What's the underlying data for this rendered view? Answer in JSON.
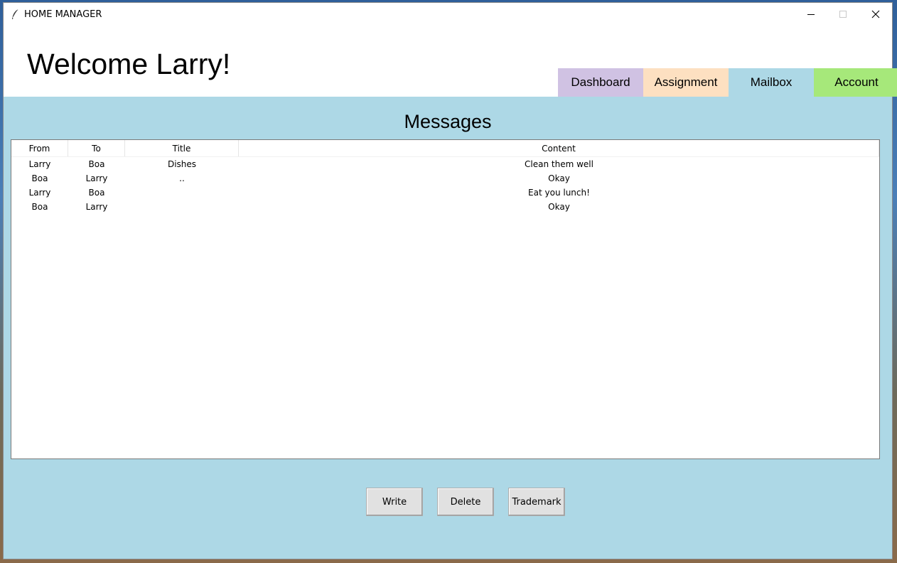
{
  "window": {
    "title": "HOME MANAGER",
    "controls": {
      "minimize_icon": "minimize-icon",
      "maximize_icon": "maximize-icon",
      "close_icon": "close-icon"
    }
  },
  "header": {
    "welcome": "Welcome Larry!",
    "tabs": [
      {
        "label": "Dashboard",
        "color": "#d0c2e3"
      },
      {
        "label": "Assignment",
        "color": "#fde0c1"
      },
      {
        "label": "Mailbox",
        "color": "#add8e6"
      },
      {
        "label": "Account",
        "color": "#a6e87a"
      }
    ],
    "active_tab": "Mailbox"
  },
  "mailbox": {
    "heading": "Messages",
    "columns": [
      "From",
      "To",
      "Title",
      "Content"
    ],
    "rows": [
      [
        "Larry",
        "Boa",
        "Dishes",
        "Clean them well"
      ],
      [
        "Boa",
        "Larry",
        "..",
        "Okay"
      ],
      [
        "Larry",
        "Boa",
        "",
        "Eat you lunch!"
      ],
      [
        "Boa",
        "Larry",
        "",
        "Okay"
      ]
    ],
    "buttons": {
      "write": "Write",
      "delete": "Delete",
      "trademark": "Trademark"
    }
  },
  "colors": {
    "content_bg": "#add8e6"
  }
}
